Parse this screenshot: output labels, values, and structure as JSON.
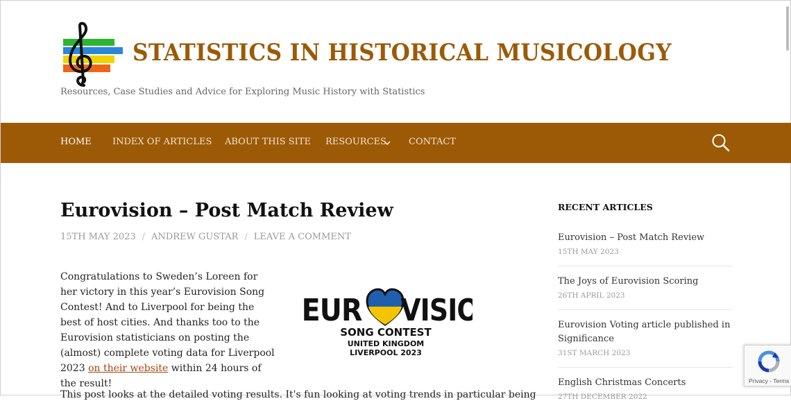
{
  "site": {
    "title": "STATISTICS IN HISTORICAL MUSICOLOGY",
    "tagline": "Resources, Case Studies and Advice for Exploring Music History with Statistics",
    "brand_color": "#9c5a06"
  },
  "nav": {
    "items": [
      {
        "label": "HOME",
        "active": true
      },
      {
        "label": "INDEX OF ARTICLES"
      },
      {
        "label": "ABOUT THIS SITE"
      },
      {
        "label": "RESOURCES",
        "has_dropdown": true
      },
      {
        "label": "CONTACT"
      }
    ],
    "search_icon": "search-icon"
  },
  "post": {
    "title": "Eurovision – Post Match Review",
    "date": "15TH MAY 2023",
    "author": "ANDREW GUSTAR",
    "comment_link": "LEAVE A COMMENT",
    "paragraph_before_link": "Congratulations to Sweden’s Loreen for her victory in this year’s Eurovision Song Contest! And to Liverpool for being the best of host cities. And thanks too to the Eurovision statisticians on posting the (almost) complete voting data for Liverpool 2023 ",
    "link_text": "on their website",
    "paragraph_after_link": " within 24 hours of the result!",
    "next_paragraph_start": "This post looks at the detailed voting results. It's fun looking at voting trends in particular being",
    "image_logo": {
      "word_left": "EUR",
      "word_right": "VISION",
      "line1": "SONG CONTEST",
      "line2": "UNITED KINGDOM",
      "line3": "LIVERPOOL 2023"
    }
  },
  "sidebar": {
    "widget_title": "RECENT ARTICLES",
    "articles": [
      {
        "title": "Eurovision – Post Match Review",
        "date": "15TH MAY 2023"
      },
      {
        "title": "The Joys of Eurovision Scoring",
        "date": "26TH APRIL 2023"
      },
      {
        "title": "Eurovision Voting article published in Significance",
        "date": "31ST MARCH 2023"
      },
      {
        "title": "English Christmas Concerts",
        "date": "27TH DECEMBER 2022"
      }
    ]
  },
  "recaptcha": {
    "privacy": "Privacy",
    "terms": "Terms",
    "separator": " - "
  }
}
